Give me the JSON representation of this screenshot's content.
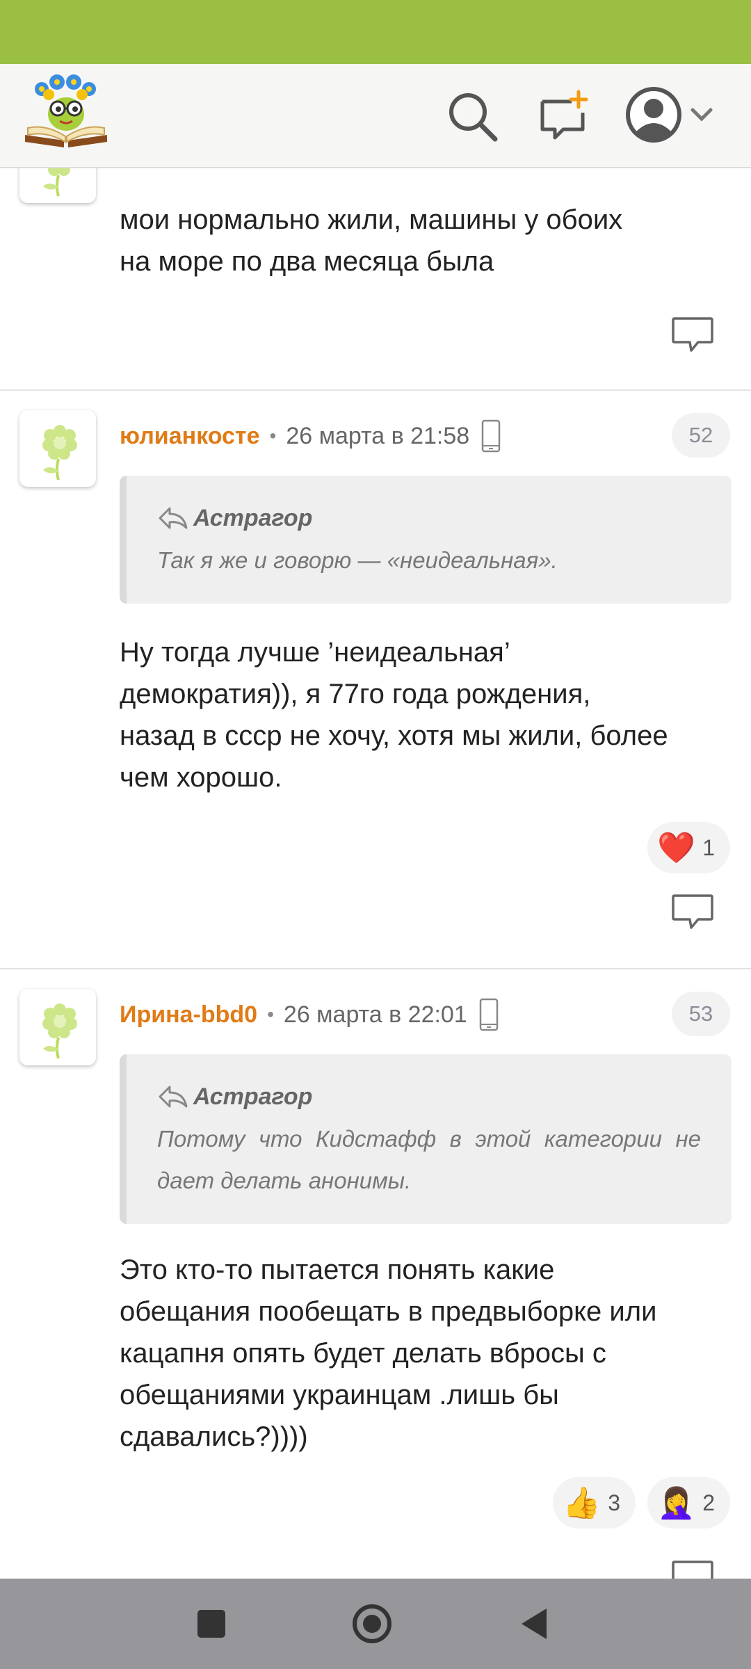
{
  "app": {
    "logo_icon": "kidstaff-logo-icon",
    "accent_color": "#9bbf43",
    "author_color": "#e07b16"
  },
  "header": {
    "icons": [
      "search-icon",
      "new-message-icon",
      "user-avatar-icon",
      "chevron-down-icon"
    ]
  },
  "comments": [
    {
      "text_lines": [
        "мои нормально жили, машины у обоих",
        "на море по два месяца была"
      ]
    },
    {
      "author": "юлианкосте",
      "date": "26 марта в 21:58",
      "number": "52",
      "quote": {
        "author": "Астрагор",
        "text": "Так я же и говорю — «неидеальная»."
      },
      "text_lines": [
        "Ну тогда лучше ’неидеальная’",
        "демократия)), я 77го года рождения,",
        "назад в ссср не хочу, хотя мы жили, более",
        "чем хорошо."
      ],
      "reactions": [
        {
          "emoji": "❤️",
          "count": "1"
        }
      ]
    },
    {
      "author": "Ирина-bbd0",
      "date": "26 марта в 22:01",
      "number": "53",
      "quote": {
        "author": "Астрагор",
        "text": "Потому что Кидстафф в этой категории не дает делать анонимы."
      },
      "text_lines": [
        "Это кто-то пытается понять какие",
        "обещания пообещать в предвыборке или",
        "кацапня опять будет делать вбросы с",
        "обещаниями украинцам .лишь бы",
        "сдавались?))))"
      ],
      "reactions": [
        {
          "emoji": "👍",
          "count": "3"
        },
        {
          "emoji": "🤦‍♀️",
          "count": "2"
        }
      ]
    }
  ],
  "navigation": {
    "buttons": [
      "recent-apps-icon",
      "home-icon",
      "back-icon"
    ]
  }
}
